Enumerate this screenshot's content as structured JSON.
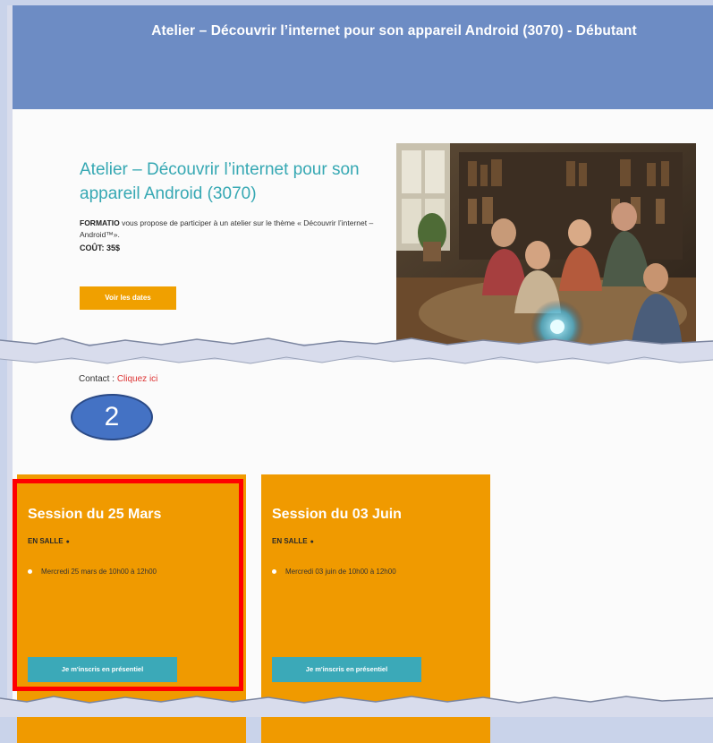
{
  "banner": {
    "title": "Atelier – Découvrir l’internet pour son appareil Android (3070) - Débutant"
  },
  "course": {
    "title": "Atelier – Découvrir l’internet pour son appareil Android (3070)",
    "desc_bold": "FORMATIO",
    "desc_rest": " vous propose de participer à un atelier sur le thème « Découvrir l’internet – Android™».",
    "cost": "COÛT: 35$",
    "dates_button": "Voir les dates"
  },
  "cut_text": {
    "prefix": "Contact :",
    "link": "Cliquez ici"
  },
  "step_badge": "2",
  "sessions": [
    {
      "title": "Session du 25 Mars",
      "mode": "EN SALLE",
      "mode_icon": "●",
      "slot": "Mercredi 25 mars de 10h00 à 12h00",
      "button": "Je m'inscris en présentiel"
    },
    {
      "title": "Session du 03 Juin",
      "mode": "EN SALLE",
      "mode_icon": "●",
      "slot": "Mercredi 03 juin de 10h00 à 12h00",
      "button": "Je m'inscris en présentiel"
    }
  ],
  "colors": {
    "banner": "#6d8cc4",
    "teal": "#36a8b3",
    "orange": "#f09a00",
    "highlight": "#ff0000",
    "badge": "#4472c4"
  }
}
